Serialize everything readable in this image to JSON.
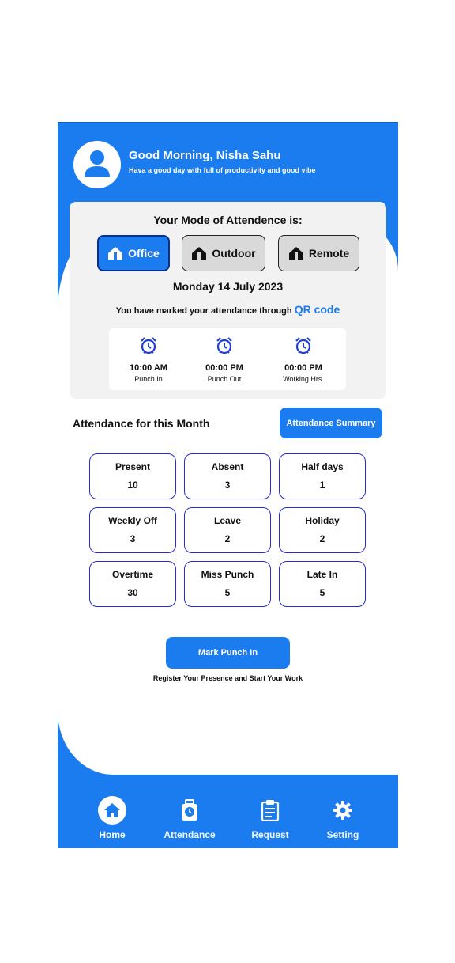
{
  "header": {
    "greeting": "Good Morning, Nisha Sahu",
    "subtitle": "Hava a good day with full of productivity and good vibe"
  },
  "mode": {
    "title": "Your Mode of Attendence is:",
    "options": [
      {
        "label": "Office",
        "icon": "office-icon",
        "active": true
      },
      {
        "label": "Outdoor",
        "icon": "outdoor-icon",
        "active": false
      },
      {
        "label": "Remote",
        "icon": "remote-icon",
        "active": false
      }
    ],
    "date": "Monday 14 July 2023",
    "marked_text": "You have marked your attendance through",
    "marked_method": "QR code"
  },
  "punch": [
    {
      "time": "10:00 AM",
      "label": "Punch In",
      "icon": "alarm-clock-icon"
    },
    {
      "time": "00:00 PM",
      "label": "Punch Out",
      "icon": "alarm-clock-icon"
    },
    {
      "time": "00:00 PM",
      "label": "Working Hrs.",
      "icon": "alarm-clock-icon"
    }
  ],
  "month": {
    "title": "Attendance for this Month",
    "summary_button": "Attendance Summary",
    "stats": [
      {
        "label": "Present",
        "value": "10"
      },
      {
        "label": "Absent",
        "value": "3"
      },
      {
        "label": "Half days",
        "value": "1"
      },
      {
        "label": "Weekly Off",
        "value": "3"
      },
      {
        "label": "Leave",
        "value": "2"
      },
      {
        "label": "Holiday",
        "value": "2"
      },
      {
        "label": "Overtime",
        "value": "30"
      },
      {
        "label": "Miss Punch",
        "value": "5"
      },
      {
        "label": "Late In",
        "value": "5"
      }
    ]
  },
  "action": {
    "button": "Mark Punch In",
    "caption": "Register Your Presence and Start Your Work"
  },
  "nav": [
    {
      "label": "Home",
      "icon": "home-icon",
      "active": true
    },
    {
      "label": "Attendance",
      "icon": "attendance-icon",
      "active": false
    },
    {
      "label": "Request",
      "icon": "clipboard-icon",
      "active": false
    },
    {
      "label": "Setting",
      "icon": "gear-icon",
      "active": false
    }
  ],
  "colors": {
    "primary": "#1b7cf0",
    "stat_border": "#2a2ad6",
    "card_bg": "#f2f2f2"
  }
}
